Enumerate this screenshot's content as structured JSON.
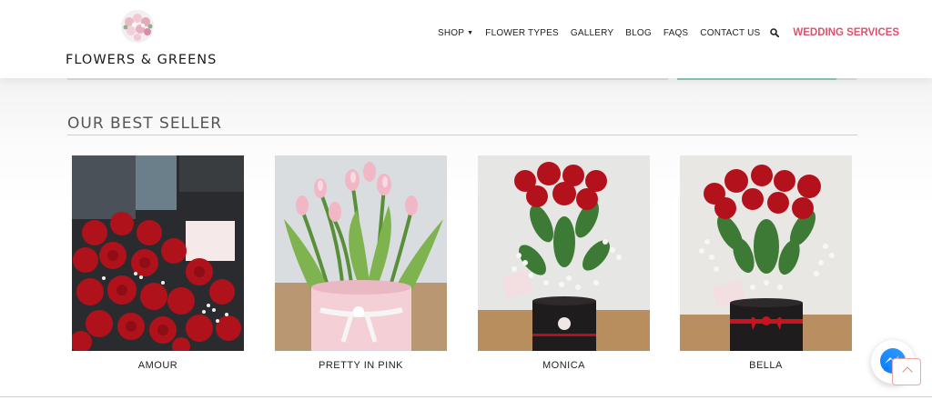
{
  "brand": {
    "name": "FLOWERS & GREENS"
  },
  "nav": {
    "items": [
      {
        "label": "SHOP",
        "has_dropdown": true
      },
      {
        "label": "FLOWER TYPES"
      },
      {
        "label": "GALLERY"
      },
      {
        "label": "BLOG"
      },
      {
        "label": "FAQS"
      },
      {
        "label": "CONTACT US"
      }
    ],
    "search_icon": "search-icon",
    "highlight": {
      "label": "WEDDING SERVICES",
      "color": "#e0516a"
    }
  },
  "bestseller": {
    "title": "OUR BEST SELLER",
    "products": [
      {
        "name": "AMOUR"
      },
      {
        "name": "PRETTY IN PINK"
      },
      {
        "name": "MONICA"
      },
      {
        "name": "BELLA"
      }
    ]
  },
  "widgets": {
    "messenger_icon": "messenger-icon",
    "scroll_top_icon": "chevron-up-icon"
  },
  "colors": {
    "accent": "#e0516a",
    "strip": "#8cc9b3"
  }
}
